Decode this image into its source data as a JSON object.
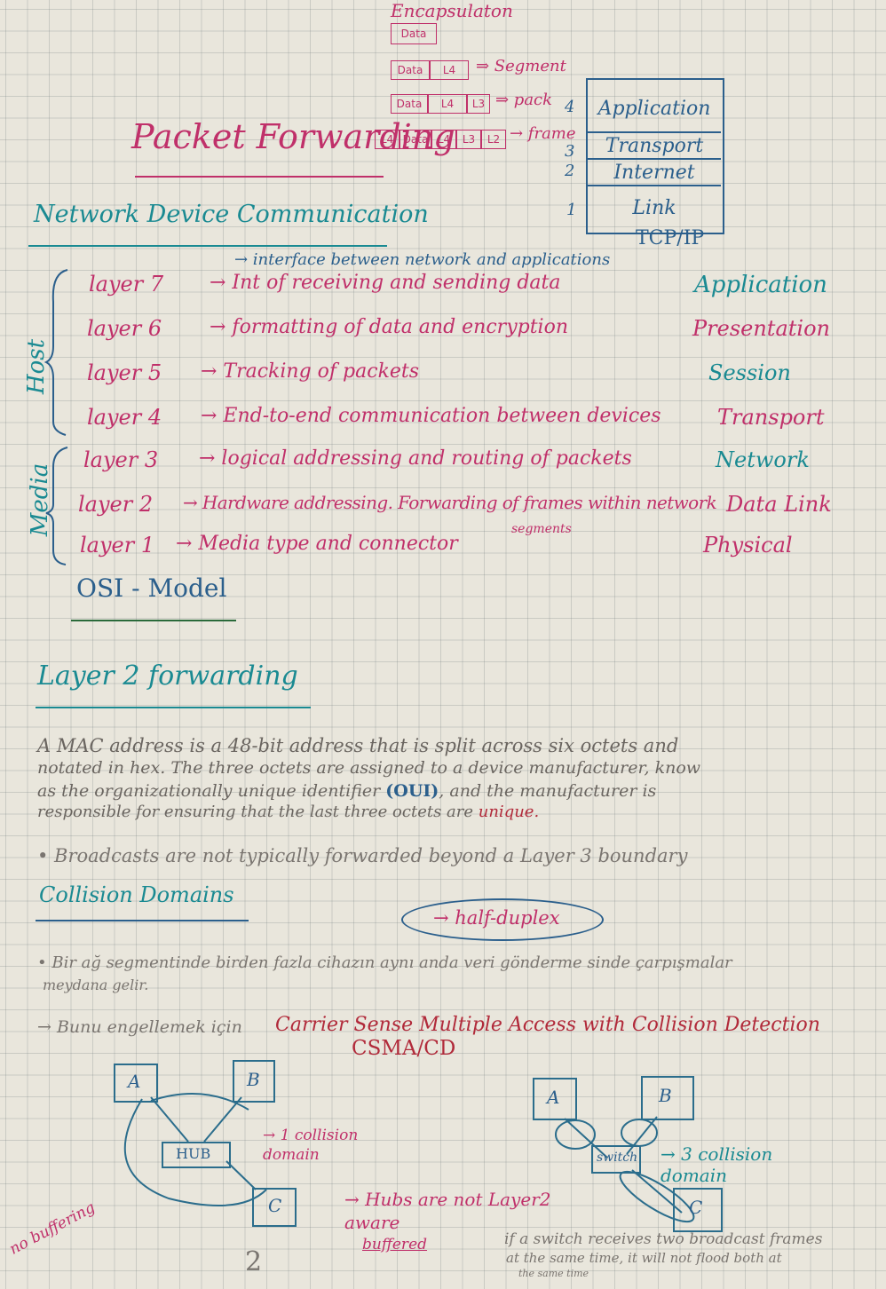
{
  "encapsulation": {
    "title": "Encapsulaton",
    "row1": [
      "Data"
    ],
    "row2": {
      "cells": [
        "Data",
        "L4"
      ],
      "arrow_label": "⇒ Segment"
    },
    "row3": {
      "cells": [
        "Data",
        "L4",
        "L3"
      ],
      "arrow_label": "⇒ pack"
    },
    "row4": {
      "cells": [
        "L4",
        "Data",
        "L4",
        "L3",
        "L2"
      ],
      "arrow_label": "→ frame"
    }
  },
  "page_title": "Packet Forwarding",
  "tcpip": {
    "layers": [
      {
        "num": "4",
        "name": "Application"
      },
      {
        "num": "3",
        "name": "Transport"
      },
      {
        "num": "2",
        "name": "Internet"
      },
      {
        "num": "1",
        "name": "Link"
      }
    ],
    "label": "TCP/IP"
  },
  "section_network": "Network Device Communication",
  "osi": {
    "top_note": "→ interface between network and applications",
    "host_label": "Host",
    "media_label": "Media",
    "rows": [
      {
        "layer": "layer 7",
        "desc": "→ Int of receiving and sending data",
        "name": "Application"
      },
      {
        "layer": "layer 6",
        "desc": "→ formatting of data and encryption",
        "name": "Presentation"
      },
      {
        "layer": "layer 5",
        "desc": "→ Tracking of packets",
        "name": "Session"
      },
      {
        "layer": "layer 4",
        "desc": "→ End-to-end communication between devices",
        "name": "Transport"
      },
      {
        "layer": "layer 3",
        "desc": "→ logical addressing and routing of packets",
        "name": "Network"
      },
      {
        "layer": "layer 2",
        "desc": "→ Hardware addressing. Forwarding of frames within network",
        "name": "Data Link"
      },
      {
        "layer": "layer 1",
        "desc": "→ Media type and connector",
        "name": "Physical"
      }
    ],
    "segments_note": "segments",
    "title": "OSI - Model"
  },
  "section_layer2": "Layer 2 forwarding",
  "mac_paragraph": {
    "line1": "A MAC address is a 48-bit address that is split across six octets and",
    "line2": "notated in hex. The three octets are assigned to a device manufacturer, know",
    "line3a": "as the organizationally unique identifier ",
    "line3b": "(OUI)",
    "line3c": ", and the manufacturer is",
    "line4a": "responsible for ensuring that the last three octets are ",
    "line4b": "unique."
  },
  "broadcast_note": "• Broadcasts are not typically forwarded beyond a Layer 3 boundary",
  "section_collision": "Collision Domains",
  "half_duplex": "→ half-duplex",
  "turkish_note": {
    "line1": "• Bir ağ segmentinde birden fazla cihazın aynı anda veri gönderme sinde çarpışmalar",
    "line2": "meydana gelir."
  },
  "csma": {
    "prefix": "→ Bunu engellemek için",
    "text": "Carrier Sense Multiple Access with Collision Detection",
    "abbr": "CSMA/CD"
  },
  "hub_diagram": {
    "node_a": "A",
    "node_b": "B",
    "node_c": "C",
    "hub": "HUB",
    "result": "→ 1 collision domain",
    "side_note": "no buffering"
  },
  "switch_diagram": {
    "node_a": "A",
    "node_b": "B",
    "node_c": "C",
    "switch": "switch",
    "result": "→ 3 collision domain"
  },
  "hub_note": "→ Hubs are not Layer2 aware",
  "buffered_note": {
    "label": "buffered",
    "line1": "if a switch receives two broadcast frames",
    "line2": "at the same time, it will not flood both at",
    "line3": "the same time"
  },
  "page_number": "2"
}
